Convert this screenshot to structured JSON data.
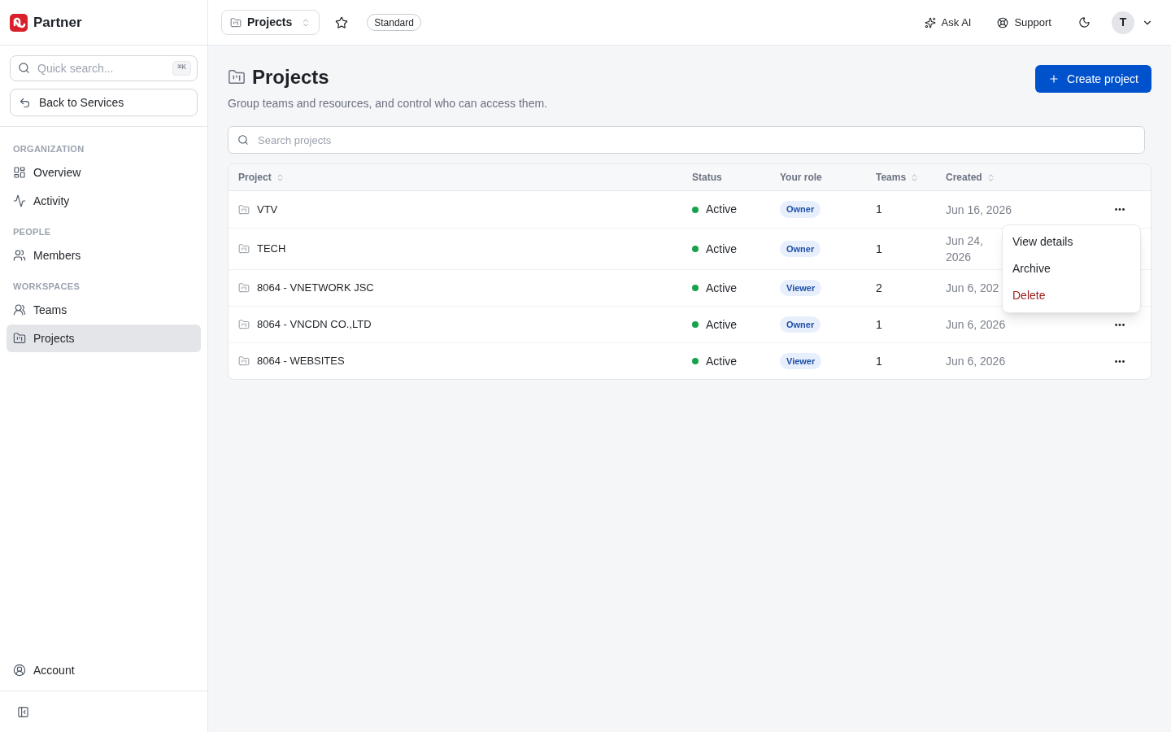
{
  "sidebar": {
    "brand": "Partner",
    "search": {
      "placeholder": "Quick search...",
      "shortcut": "⌘K"
    },
    "back_button": "Back to Services",
    "sections": [
      {
        "title": "ORGANIZATION",
        "items": [
          {
            "label": "Overview",
            "selected": false
          },
          {
            "label": "Activity",
            "selected": false
          }
        ]
      },
      {
        "title": "PEOPLE",
        "items": [
          {
            "label": "Members",
            "selected": false
          }
        ]
      },
      {
        "title": "WORKSPACES",
        "items": [
          {
            "label": "Teams",
            "selected": false
          },
          {
            "label": "Projects",
            "selected": true
          }
        ]
      }
    ],
    "footer_item": "Account"
  },
  "topbar": {
    "breadcrumb": "Projects",
    "starred": false,
    "plan_badge": "Standard",
    "ask_ai": "Ask AI",
    "support": "Support",
    "avatar_initial": "T"
  },
  "page": {
    "title": "Projects",
    "subtitle": "Group teams and resources, and control who can access them.",
    "create_button": "Create project",
    "search": {
      "placeholder": "Search projects"
    }
  },
  "table": {
    "columns": [
      {
        "label": "Project",
        "sortable": true
      },
      {
        "label": "Status",
        "sortable": false
      },
      {
        "label": "Your role",
        "sortable": false
      },
      {
        "label": "Teams",
        "sortable": true
      },
      {
        "label": "Created",
        "sortable": true
      }
    ],
    "rows": [
      {
        "project": "VTV",
        "status": "Active",
        "role": "Owner",
        "teams": "1",
        "created": "Jun 16, 2026",
        "menu": {
          "items": [
            {
              "label": "View details",
              "kind": "normal"
            },
            {
              "label": "Archive",
              "kind": "normal"
            },
            {
              "label": "Delete",
              "kind": "danger"
            }
          ]
        }
      },
      {
        "project": "TECH",
        "status": "Active",
        "role": "Owner",
        "teams": "1",
        "created": "Jun 24, 2026"
      },
      {
        "project": "8064 - VNETWORK JSC",
        "status": "Active",
        "role": "Viewer",
        "teams": "2",
        "created": "Jun 6, 202"
      },
      {
        "project": "8064 - VNCDN CO.,LTD",
        "status": "Active",
        "role": "Owner",
        "teams": "1",
        "created": "Jun 6, 2026"
      },
      {
        "project": "8064 - WEBSITES",
        "status": "Active",
        "role": "Viewer",
        "teams": "1",
        "created": "Jun 6, 2026"
      }
    ]
  }
}
